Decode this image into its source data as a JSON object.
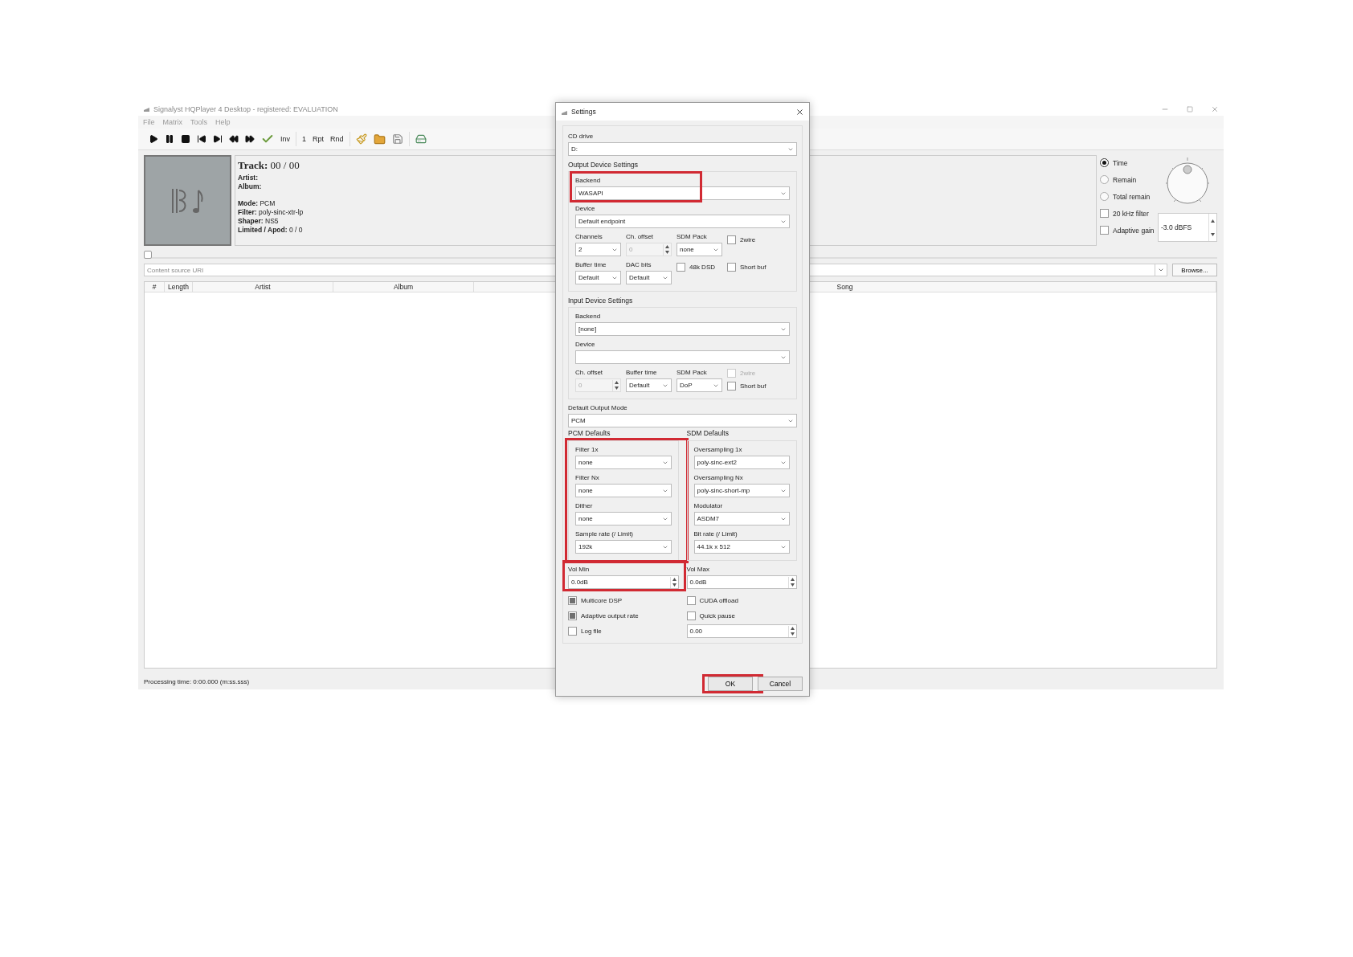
{
  "window": {
    "title": "Signalyst HQPlayer 4 Desktop - registered: EVALUATION"
  },
  "menu": [
    "File",
    "Matrix",
    "Tools",
    "Help"
  ],
  "toolbar": {
    "text_buttons": [
      "Inv",
      "1",
      "Rpt",
      "Rnd"
    ]
  },
  "now_playing": {
    "track_label": "Track:",
    "track_value": "00 / 00",
    "details": [
      {
        "label": "Artist:"
      },
      {
        "label": "Album:"
      }
    ],
    "format": [
      {
        "label": "Mode:",
        "value": "PCM"
      },
      {
        "label": "Filter:",
        "value": "poly-sinc-xtr-lp"
      },
      {
        "label": "Shaper:",
        "value": "NS5"
      },
      {
        "label": "Limited / Apod:",
        "value": "0 / 0"
      }
    ]
  },
  "time_display": [
    {
      "label": "Time",
      "selected": true
    },
    {
      "label": "Remain",
      "selected": false
    },
    {
      "label": "Total remain",
      "selected": false
    }
  ],
  "toggles": [
    {
      "label": "20 kHz filter",
      "checked": false
    },
    {
      "label": "Adaptive gain",
      "checked": false
    }
  ],
  "volume": {
    "value": "-3.0 dBFS"
  },
  "position": {
    "level": 0
  },
  "source": {
    "placeholder": "Content source URI",
    "browse": "Browse..."
  },
  "table": {
    "columns": [
      "#",
      "Length",
      "Artist",
      "Album",
      "Song"
    ]
  },
  "status_bar": "Processing time: 0:00.000 (m:ss.sss)",
  "dialog": {
    "title": "Settings",
    "cd_drive": {
      "label": "CD drive",
      "value": "D:"
    },
    "output": {
      "title": "Output Device Settings",
      "backend": {
        "label": "Backend",
        "value": "WASAPI",
        "highlighted": true
      },
      "device": {
        "label": "Device",
        "value": "Default endpoint"
      },
      "channels": {
        "label": "Channels",
        "value": "2"
      },
      "ch_offset": {
        "label": "Ch. offset",
        "value": "0",
        "disabled": true
      },
      "sdm_pack": {
        "label": "SDM Pack",
        "value": "none"
      },
      "two_wire": {
        "label": "2wire",
        "checked": false,
        "disabled": false
      },
      "buffer_time": {
        "label": "Buffer time",
        "value": "Default"
      },
      "dac_bits": {
        "label": "DAC bits",
        "value": "Default"
      },
      "dsd_48k": {
        "label": "48k DSD",
        "checked": false
      },
      "short_buf": {
        "label": "Short buf",
        "checked": false
      }
    },
    "input": {
      "title": "Input Device Settings",
      "backend": {
        "label": "Backend",
        "value": "[none]"
      },
      "device": {
        "label": "Device"
      },
      "ch_offset": {
        "label": "Ch. offset",
        "value": "0",
        "disabled": true
      },
      "buffer_time": {
        "label": "Buffer time",
        "value": "Default"
      },
      "sdm_pack": {
        "label": "SDM Pack",
        "value": "DoP"
      },
      "two_wire": {
        "label": "2wire",
        "checked": false,
        "disabled": true
      },
      "short_buf": {
        "label": "Short buf",
        "checked": false
      }
    },
    "default_output_mode": {
      "label": "Default Output Mode",
      "value": "PCM"
    },
    "pcm_defaults": {
      "title": "PCM Defaults",
      "highlighted": true,
      "fields": [
        {
          "label": "Filter 1x",
          "value": "none"
        },
        {
          "label": "Filter Nx",
          "value": "none"
        },
        {
          "label": "Dither",
          "value": "none"
        },
        {
          "label": "Sample rate (/ Limit)",
          "value": "192k"
        }
      ]
    },
    "sdm_defaults": {
      "title": "SDM Defaults",
      "fields": [
        {
          "label": "Oversampling 1x",
          "value": "poly-sinc-ext2"
        },
        {
          "label": "Oversampling Nx",
          "value": "poly-sinc-short-mp"
        },
        {
          "label": "Modulator",
          "value": "ASDM7"
        },
        {
          "label": "Bit rate (/ Limit)",
          "value": "44.1k x 512"
        }
      ]
    },
    "vol_min": {
      "label": "Vol Min",
      "value": "0.0dB",
      "highlighted": true
    },
    "vol_max": {
      "label": "Vol Max",
      "value": "0.0dB"
    },
    "options": [
      {
        "kind": "checkbox",
        "label": "Multicore DSP",
        "checked": true
      },
      {
        "kind": "checkbox",
        "label": "CUDA offload",
        "checked": false
      },
      {
        "kind": "checkbox",
        "label": "Adaptive output rate",
        "checked": true
      },
      {
        "kind": "checkbox",
        "label": "Quick pause",
        "checked": false
      },
      {
        "kind": "checkbox",
        "label": "Log file",
        "checked": false
      },
      {
        "kind": "spin",
        "value": "0.00"
      }
    ],
    "buttons": [
      {
        "label": "OK",
        "highlighted": true
      },
      {
        "label": "Cancel",
        "highlighted": false
      }
    ]
  }
}
